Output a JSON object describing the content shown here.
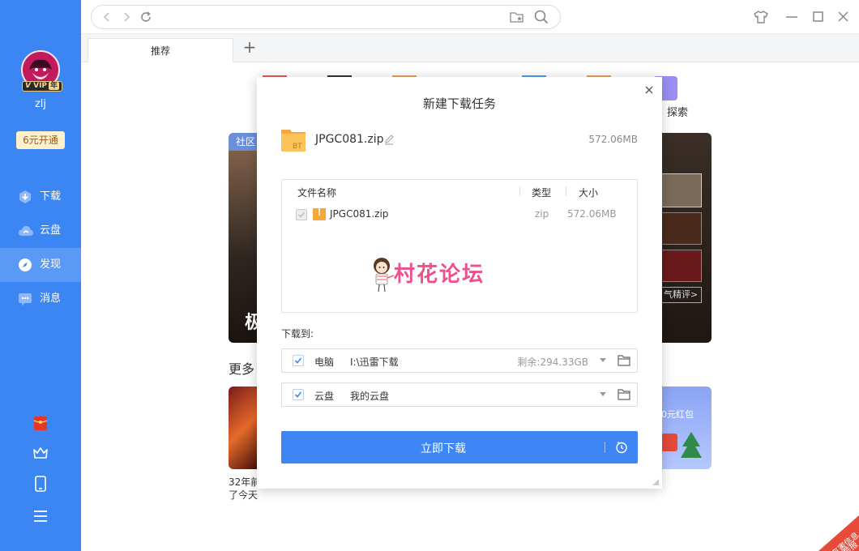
{
  "sidebar": {
    "user": {
      "name": "zlj",
      "vip_badge": "VIP",
      "vip_year": "年"
    },
    "open_vip_label": "6元开通",
    "nav": [
      {
        "label": "下载",
        "icon": "download-icon"
      },
      {
        "label": "云盘",
        "icon": "cloud-icon"
      },
      {
        "label": "发现",
        "icon": "compass-icon",
        "active": true
      },
      {
        "label": "消息",
        "icon": "message-icon"
      }
    ],
    "bottom_icons": [
      "red-packet-icon",
      "crown-icon",
      "phone-icon",
      "menu-icon"
    ]
  },
  "browser": {
    "tab_label": "推荐",
    "new_tab_symbol": "+"
  },
  "background": {
    "explore_label": "探索",
    "badge_label": "社区",
    "big_char": "极",
    "more_label": "更多",
    "hot_review": "气精评>",
    "red_packet_banner": "0元红包",
    "card_caption_line1": "32年前",
    "card_caption_line2": "了今天"
  },
  "dialog": {
    "title": "新建下载任务",
    "file_name": "JPGC081.zip",
    "file_size": "572.06MB",
    "folder_tag": "BT",
    "list": {
      "headers": {
        "name": "文件名称",
        "type": "类型",
        "size": "大小"
      },
      "rows": [
        {
          "name": "JPGC081.zip",
          "type": "zip",
          "size": "572.06MB"
        }
      ]
    },
    "watermark": "村花论坛",
    "download_to_label": "下载到:",
    "destinations": [
      {
        "label": "电脑",
        "path": "I:\\迅雷下载",
        "free": "剩余:294.33GB"
      },
      {
        "label": "云盘",
        "path": "我的云盘",
        "free": ""
      }
    ],
    "download_button": "立即下载"
  },
  "report_stamp": {
    "line1": "有害信息",
    "line2": "举报"
  },
  "colors": {
    "sidebar": "#3c86f4",
    "primary": "#3e86f5",
    "watermark": "#ee4f8d"
  }
}
